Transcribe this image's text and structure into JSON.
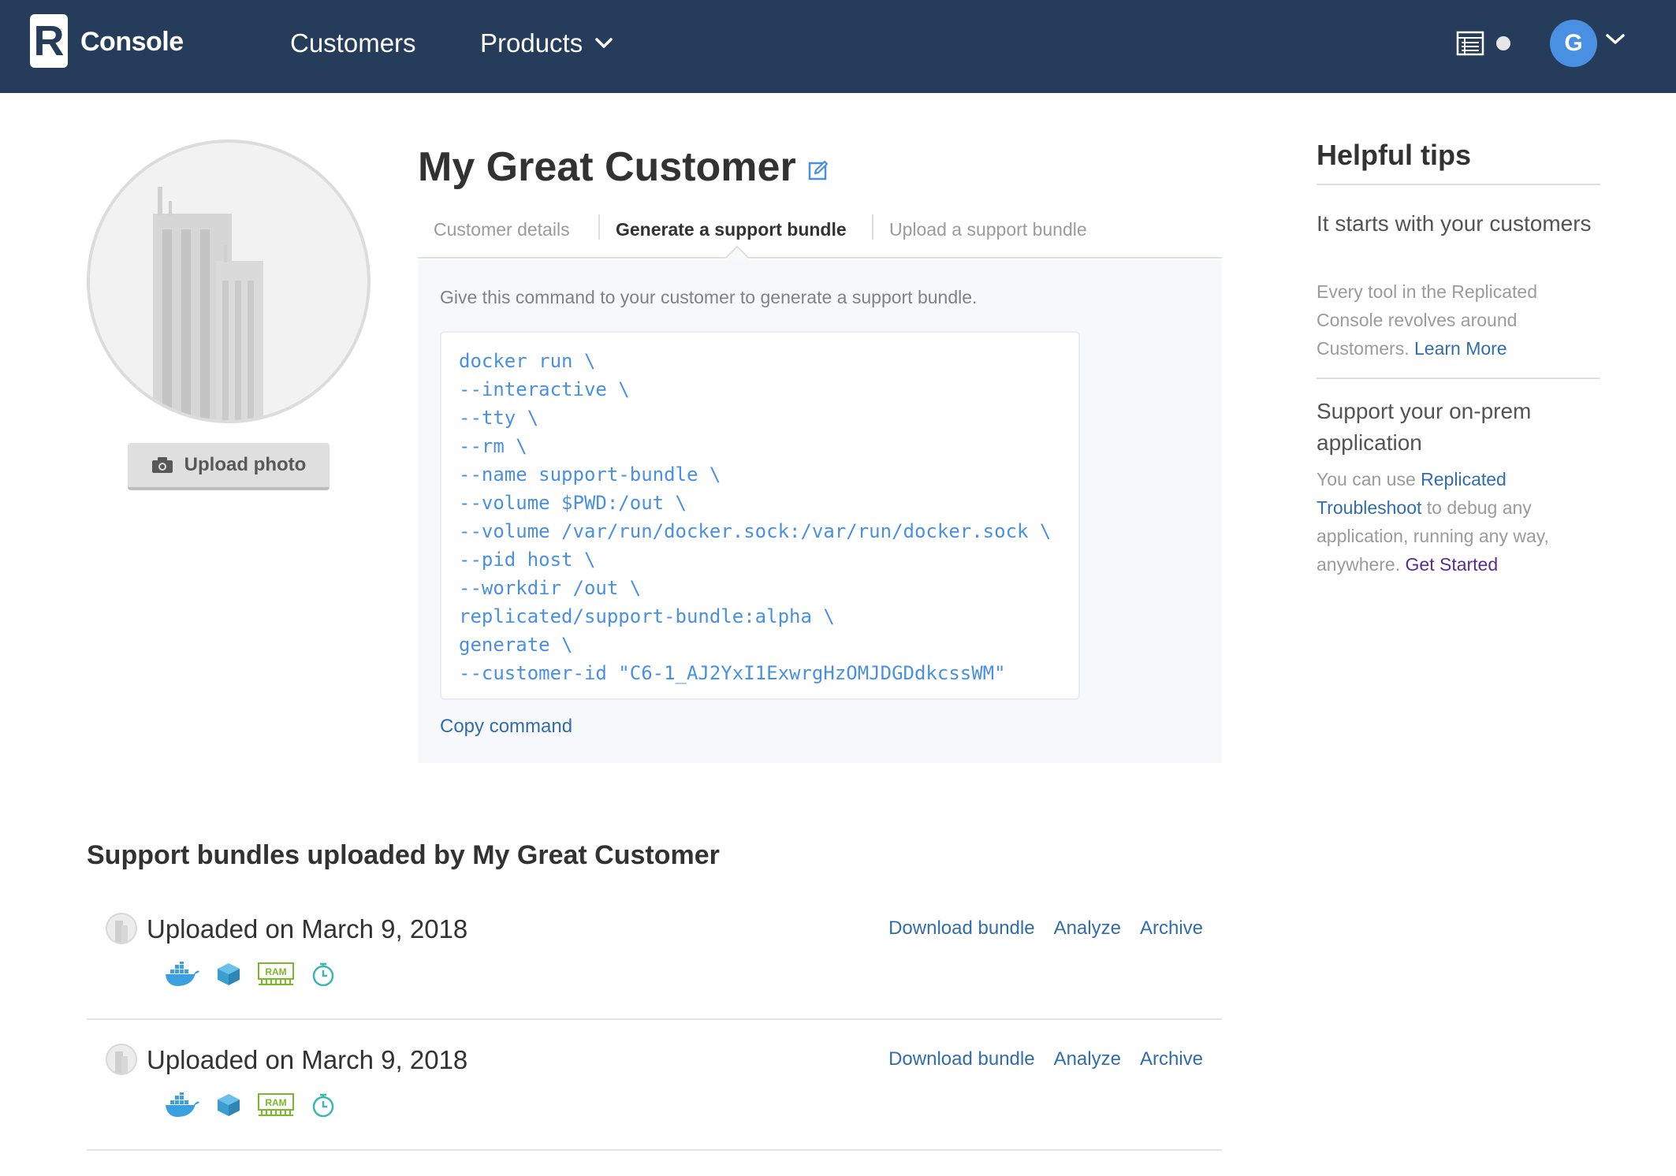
{
  "header": {
    "logo_letter": "R",
    "brand": "Console",
    "nav": {
      "customers": "Customers",
      "products": "Products"
    },
    "avatar_initial": "G",
    "colors": {
      "bar": "#253c5b",
      "avatar": "#4a90e2"
    }
  },
  "customer": {
    "name": "My Great Customer",
    "upload_photo_label": "Upload photo"
  },
  "tabs": {
    "details": "Customer details",
    "generate": "Generate a support bundle",
    "upload": "Upload a support bundle",
    "active": "generate"
  },
  "command_panel": {
    "intro": "Give this command to your customer to generate a support bundle.",
    "lines": [
      "docker run \\",
      "--interactive \\",
      "--tty \\",
      "--rm \\",
      "--name support-bundle \\",
      "--volume $PWD:/out \\",
      "--volume /var/run/docker.sock:/var/run/docker.sock \\",
      "--pid host \\",
      "--workdir /out \\",
      "replicated/support-bundle:alpha \\",
      "generate \\",
      "--customer-id \"C6-1_AJ2YxI1ExwrgHzOMJDGDdkcssWM\""
    ],
    "copy_label": "Copy command"
  },
  "bundles": {
    "heading": "Support bundles uploaded by My Great Customer",
    "items": [
      {
        "title": "Uploaded on March 9, 2018",
        "actions": {
          "download": "Download bundle",
          "analyze": "Analyze",
          "archive": "Archive"
        },
        "icons": [
          "docker-icon",
          "cube-icon",
          "ram-icon",
          "timer-icon"
        ],
        "ram_label": "RAM"
      },
      {
        "title": "Uploaded on March 9, 2018",
        "actions": {
          "download": "Download bundle",
          "analyze": "Analyze",
          "archive": "Archive"
        },
        "icons": [
          "docker-icon",
          "cube-icon",
          "ram-icon",
          "timer-icon"
        ],
        "ram_label": "RAM"
      }
    ]
  },
  "tips": {
    "heading": "Helpful tips",
    "tip1": {
      "title": "It starts with your customers",
      "body": "Every tool in the Replicated Console revolves around Customers.",
      "link": "Learn More"
    },
    "tip2": {
      "title": "Support your on-prem application",
      "body_before": "You can use",
      "link": "Replicated Troubleshoot",
      "body_after": "to debug any application, running any way, anywhere.",
      "link2": "Get Started"
    }
  }
}
